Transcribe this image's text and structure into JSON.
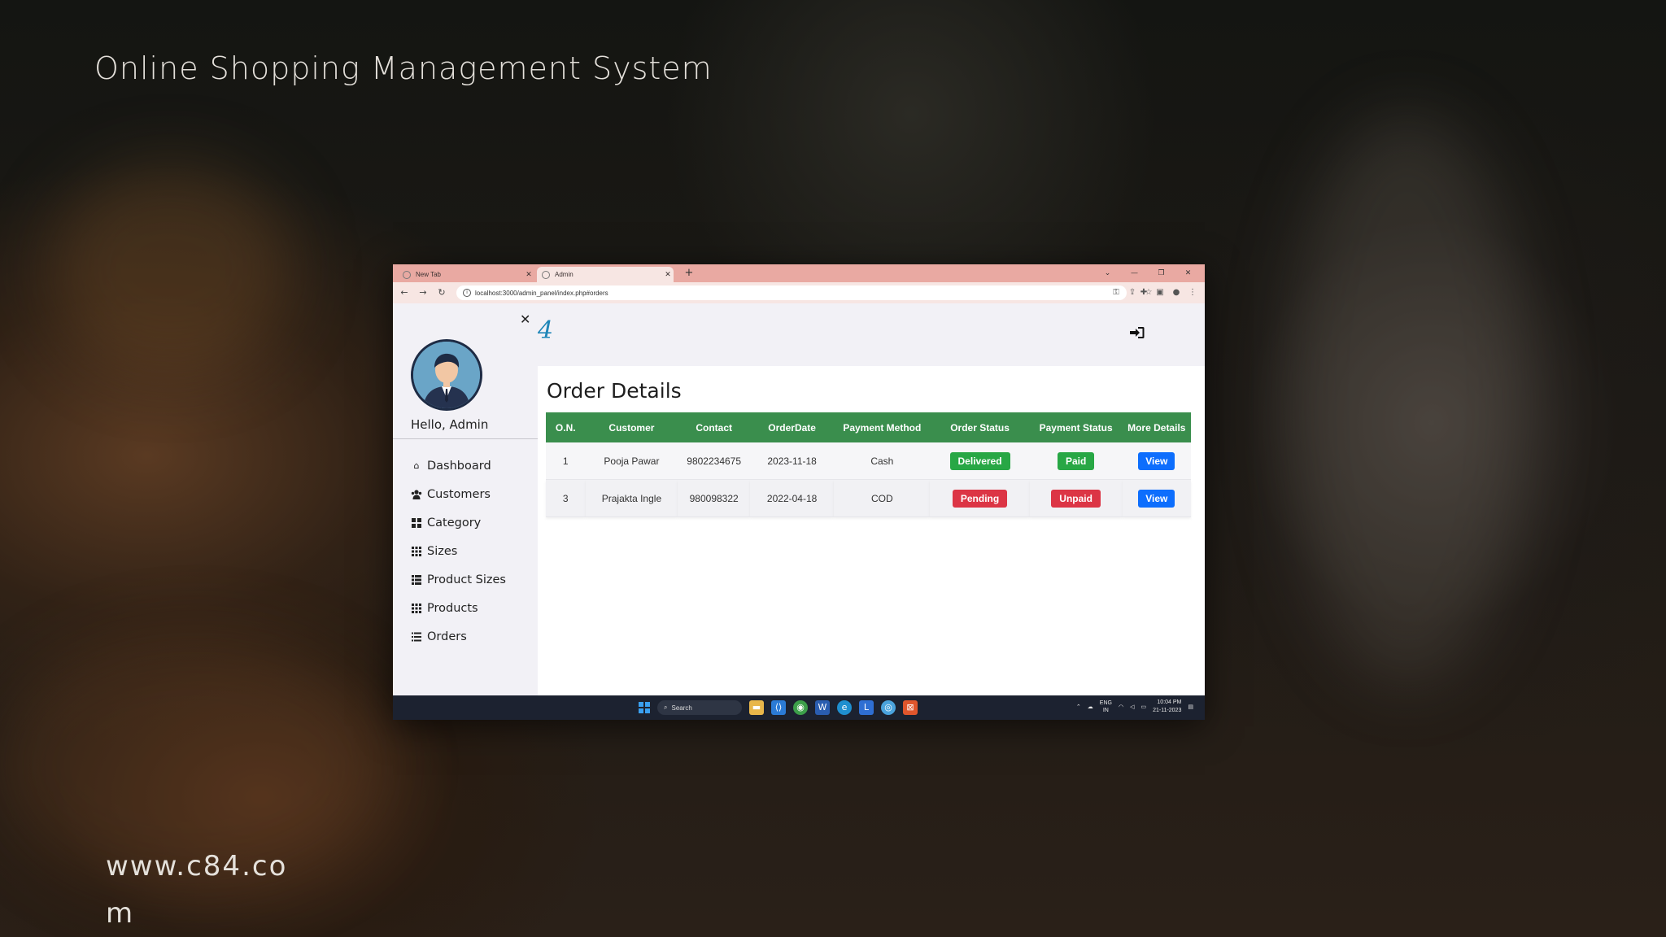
{
  "background": {
    "title": "Online Shopping Management System",
    "watermark_url": "www.c84.com"
  },
  "browser": {
    "tabs": [
      {
        "label": "New Tab",
        "active": false
      },
      {
        "label": "Admin",
        "active": true
      }
    ],
    "new_tab_icon": "plus-icon",
    "url": "localhost:3000/admin_panel/index.php#orders"
  },
  "sidebar": {
    "close_icon": "close-icon",
    "greeting": "Hello, Admin",
    "items": [
      {
        "label": "Dashboard",
        "icon": "home-icon"
      },
      {
        "label": "Customers",
        "icon": "users-icon"
      },
      {
        "label": "Category",
        "icon": "th-large-icon"
      },
      {
        "label": "Sizes",
        "icon": "grid-icon"
      },
      {
        "label": "Product Sizes",
        "icon": "list-grid-icon"
      },
      {
        "label": "Products",
        "icon": "grid-icon"
      },
      {
        "label": "Orders",
        "icon": "list-icon"
      }
    ]
  },
  "topbar": {
    "logo": "4",
    "logout_icon": "sign-in-icon"
  },
  "main": {
    "title": "Order Details",
    "columns": [
      "O.N.",
      "Customer",
      "Contact",
      "OrderDate",
      "Payment Method",
      "Order Status",
      "Payment Status",
      "More Details"
    ],
    "orders": [
      {
        "on": "1",
        "customer": "Pooja Pawar",
        "contact": "9802234675",
        "date": "2023-11-18",
        "method": "Cash",
        "order_status": "Delivered",
        "payment_status": "Paid",
        "action": "View"
      },
      {
        "on": "3",
        "customer": "Prajakta Ingle",
        "contact": "980098322",
        "date": "2022-04-18",
        "method": "COD",
        "order_status": "Pending",
        "payment_status": "Unpaid",
        "action": "View"
      }
    ],
    "colors": {
      "header": "#3a8e4d",
      "success": "#28a745",
      "danger": "#dc3545",
      "primary": "#0d6efd"
    }
  },
  "taskbar": {
    "search_label": "Search",
    "lang_top": "ENG",
    "lang_bottom": "IN",
    "time": "10:04 PM",
    "date": "21-11-2023"
  }
}
